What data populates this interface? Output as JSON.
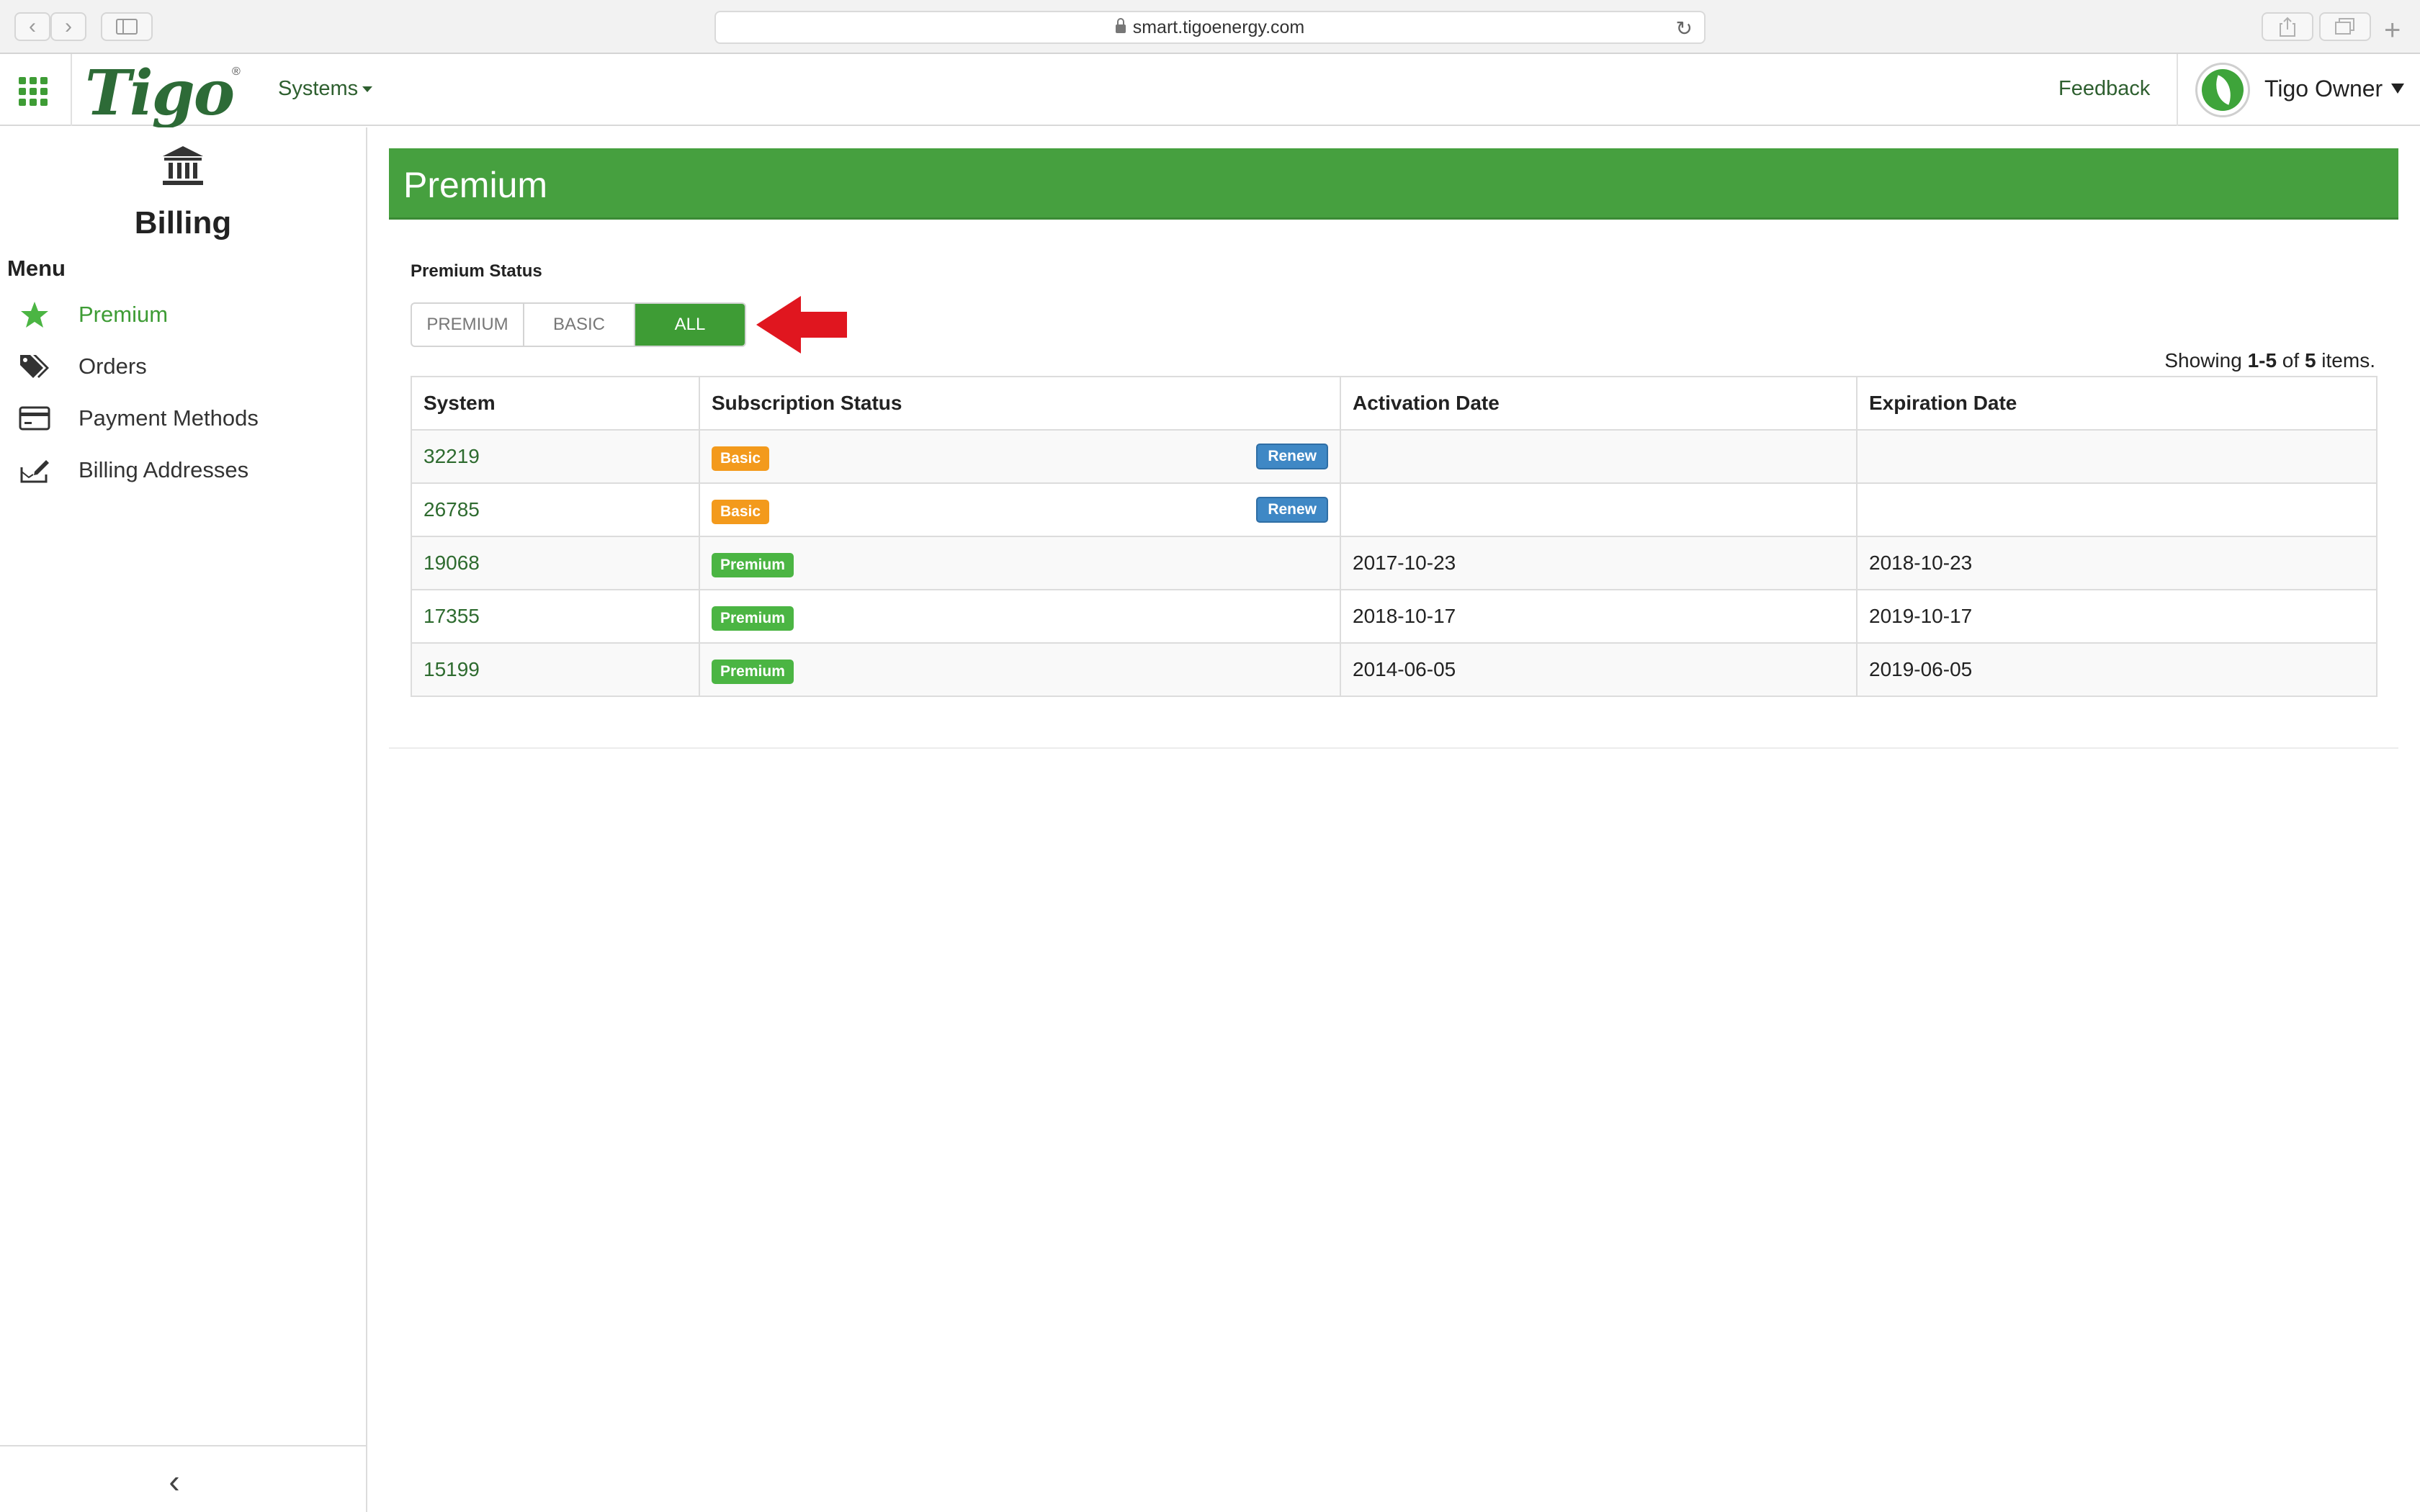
{
  "browser": {
    "url": "smart.tigoenergy.com"
  },
  "header": {
    "logo_text": "Tigo",
    "logo_mark": "®",
    "systems_label": "Systems",
    "feedback_label": "Feedback",
    "user_name": "Tigo Owner"
  },
  "sidebar": {
    "title": "Billing",
    "menu_label": "Menu",
    "items": [
      {
        "label": "Premium",
        "icon": "star-icon",
        "active": true
      },
      {
        "label": "Orders",
        "icon": "tags-icon",
        "active": false
      },
      {
        "label": "Payment Methods",
        "icon": "credit-card-icon",
        "active": false
      },
      {
        "label": "Billing Addresses",
        "icon": "address-edit-icon",
        "active": false
      }
    ],
    "collapse_glyph": "‹"
  },
  "main": {
    "banner_title": "Premium",
    "status_label": "Premium Status",
    "filter_options": [
      "PREMIUM",
      "BASIC",
      "ALL"
    ],
    "selected_filter": "ALL",
    "showing_prefix": "Showing ",
    "showing_range": "1-5",
    "showing_of": " of ",
    "showing_total": "5",
    "showing_suffix": " items.",
    "table": {
      "columns": [
        "System",
        "Subscription Status",
        "Activation Date",
        "Expiration Date"
      ],
      "rows": [
        {
          "system": "32219",
          "status": "Basic",
          "renew": "Renew",
          "activation": "",
          "expiration": ""
        },
        {
          "system": "26785",
          "status": "Basic",
          "renew": "Renew",
          "activation": "",
          "expiration": ""
        },
        {
          "system": "19068",
          "status": "Premium",
          "renew": "",
          "activation": "2017-10-23",
          "expiration": "2018-10-23"
        },
        {
          "system": "17355",
          "status": "Premium",
          "renew": "",
          "activation": "2018-10-17",
          "expiration": "2019-10-17"
        },
        {
          "system": "15199",
          "status": "Premium",
          "renew": "",
          "activation": "2014-06-05",
          "expiration": "2019-06-05"
        }
      ]
    }
  },
  "colors": {
    "brand_green": "#3e9c35",
    "banner_green": "#46a03f",
    "basic_orange": "#f39a1c",
    "premium_green": "#4bb543",
    "renew_blue": "#3f88c5",
    "annotation_red": "#e0161f"
  }
}
